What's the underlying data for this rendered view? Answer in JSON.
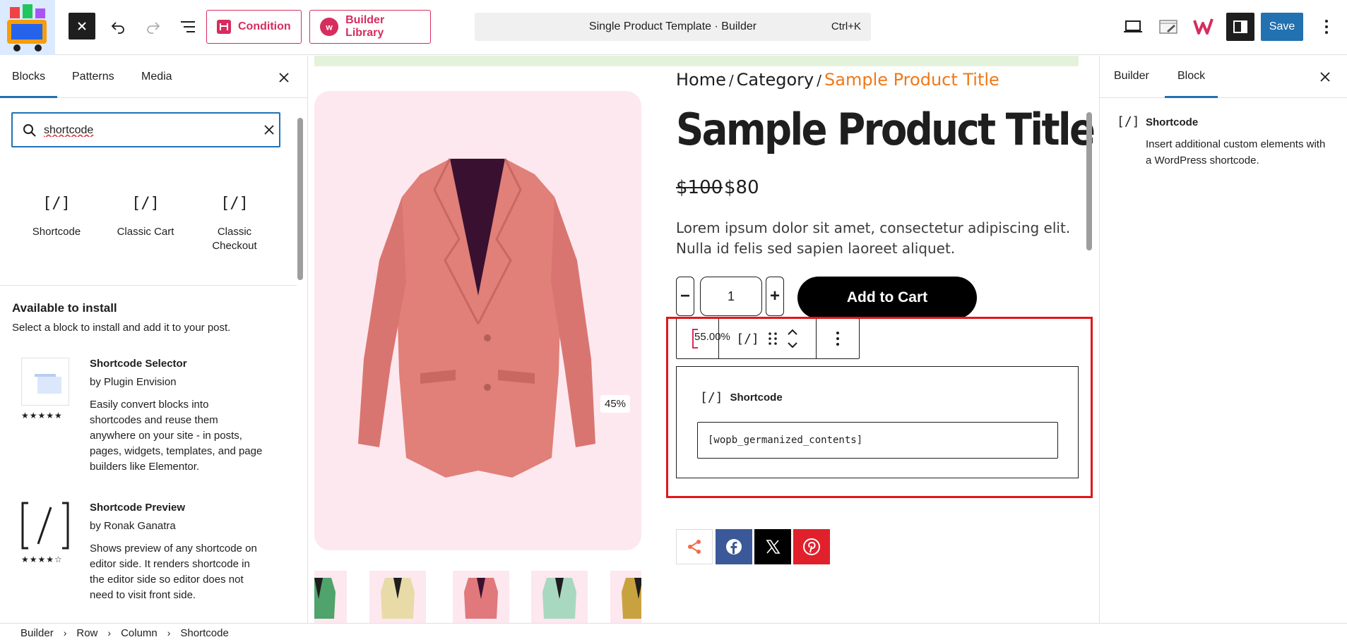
{
  "topbar": {
    "condition_label": "Condition",
    "library_label": "Builder Library",
    "command_title": "Single Product Template · Builder",
    "command_shortcut": "Ctrl+K",
    "save_label": "Save"
  },
  "inserter": {
    "tabs": [
      "Blocks",
      "Patterns",
      "Media"
    ],
    "search_value": "shortcode",
    "blocks": [
      {
        "icon": "[/]",
        "label": "Shortcode"
      },
      {
        "icon": "[/]",
        "label": "Classic Cart"
      },
      {
        "icon": "[/]",
        "label": "Classic Checkout"
      }
    ],
    "available_title": "Available to install",
    "available_subtitle": "Select a block to install and add it to your post.",
    "plugins": [
      {
        "name": "Shortcode Selector",
        "author": "by Plugin Envision",
        "stars": "★★★★★",
        "rating": 5,
        "description": "Easily convert blocks into shortcodes and reuse them anywhere on your site - in posts, pages, widgets, templates, and page builders like Elementor."
      },
      {
        "name": "Shortcode Preview",
        "author": "by Ronak Ganatra",
        "stars": "★★★★☆",
        "rating": 3.5,
        "description": "Shows preview of any shortcode on editor side. It renders shortcode in the editor side so editor does not need to visit front side."
      }
    ]
  },
  "canvas": {
    "breadcrumb": [
      "Home",
      "Category",
      "Sample Product Title"
    ],
    "breadcrumb_sep": "/",
    "product_title": "Sample Product Title",
    "price_old": "$100",
    "price_new": "$80",
    "description": "Lorem ipsum dolor sit amet, consectetur adipiscing elit. Nulla id felis sed sapien laoreet aliquet.",
    "qty_minus": "−",
    "qty_value": "1",
    "qty_plus": "+",
    "add_to_cart": "Add to Cart",
    "gallery_percent": "45%",
    "toolbar_percent": "55.00%",
    "toolbar_block_icon": "[/]",
    "shortcode_block": {
      "icon": "[/]",
      "label": "Shortcode",
      "value": "[wopb_germanized_contents]"
    },
    "jacket_colors": {
      "main": "#e08078",
      "thumbs": [
        "#4fa36b",
        "#e8dba8",
        "#e0787c",
        "#a9d8c0",
        "#c9a240"
      ]
    },
    "share_colors": {
      "facebook": "#3b5998",
      "x": "#000000",
      "pinterest": "#e0212c",
      "share": "#f26b4c"
    }
  },
  "settings": {
    "tabs": [
      "Builder",
      "Block"
    ],
    "block_icon": "[/]",
    "block_title": "Shortcode",
    "block_description": "Insert additional custom elements with a WordPress shortcode."
  },
  "footer": {
    "crumbs": [
      "Builder",
      "Row",
      "Column",
      "Shortcode"
    ]
  }
}
